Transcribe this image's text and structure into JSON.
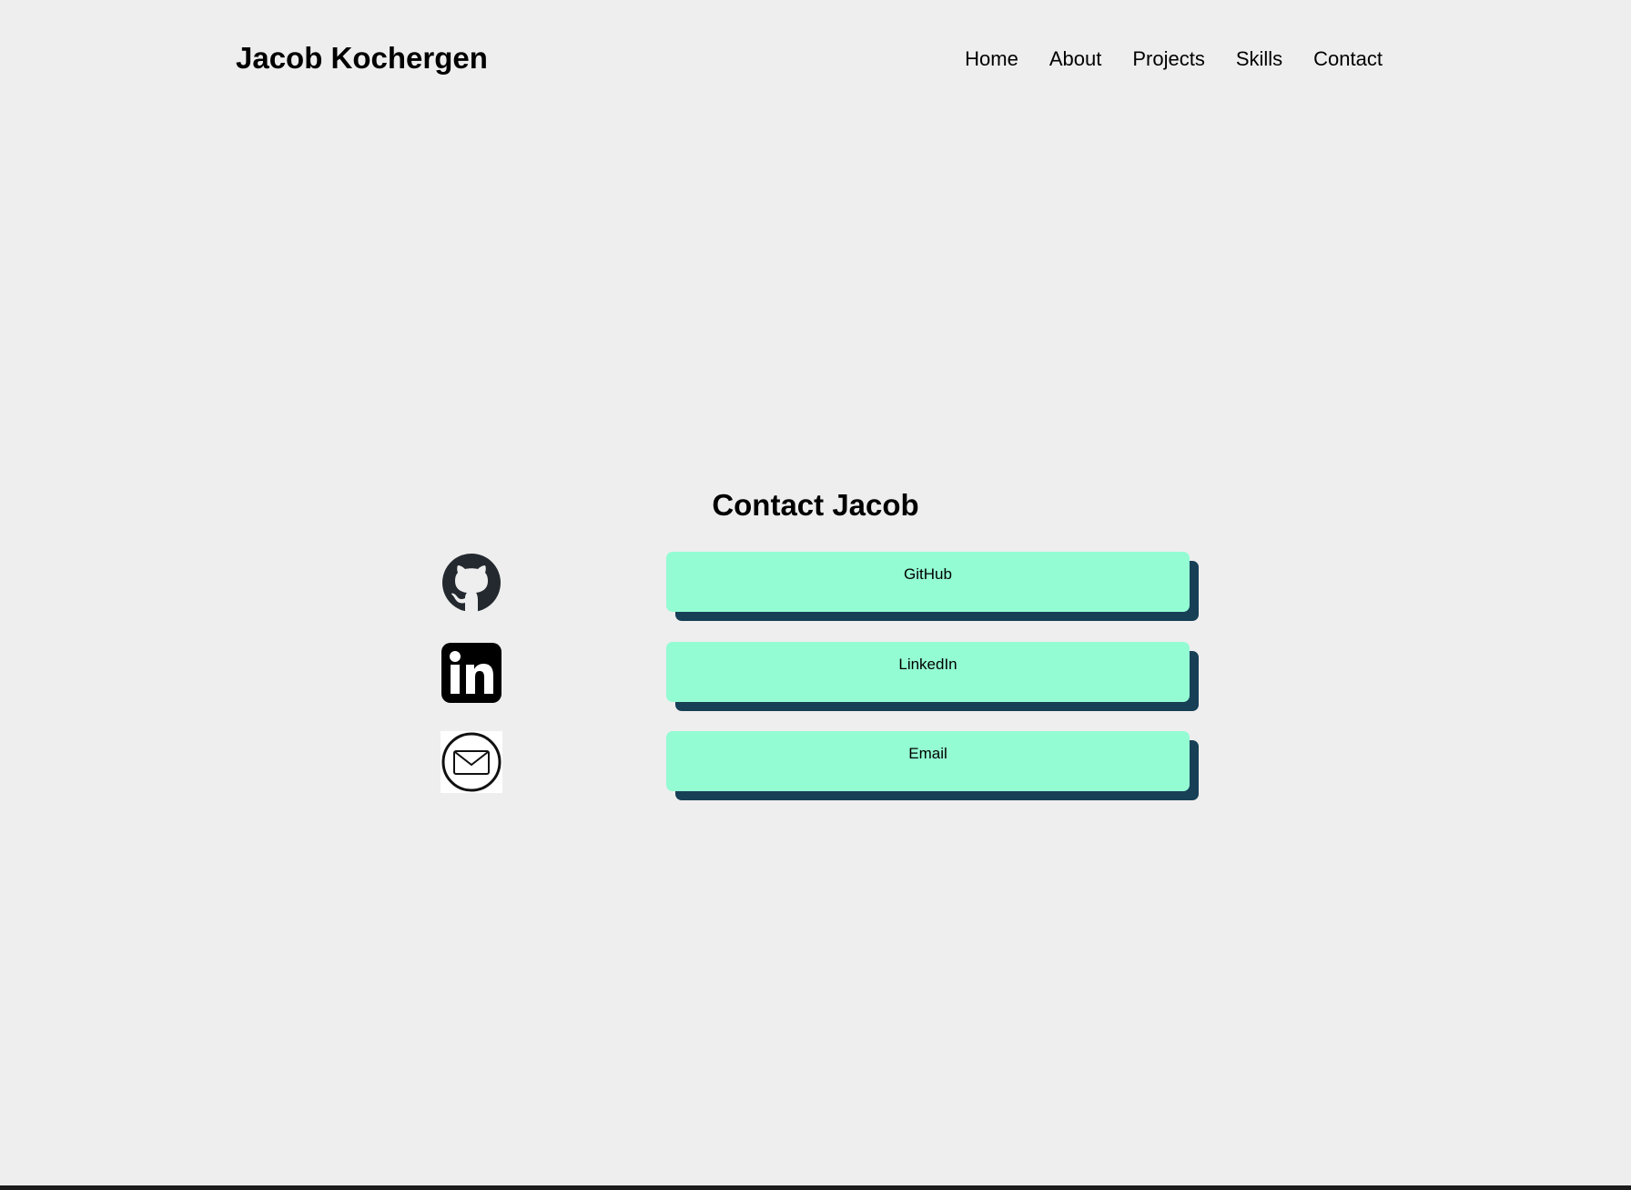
{
  "header": {
    "brand": "Jacob Kochergen",
    "nav": [
      "Home",
      "About",
      "Projects",
      "Skills",
      "Contact"
    ]
  },
  "contact": {
    "title": "Contact Jacob",
    "links": [
      {
        "label": "GitHub",
        "icon": "github-icon"
      },
      {
        "label": "LinkedIn",
        "icon": "linkedin-icon"
      },
      {
        "label": "Email",
        "icon": "email-icon"
      }
    ]
  },
  "colors": {
    "background": "#eeeeee",
    "button": "#93fcd3",
    "button_shadow": "#173f56",
    "footer": "#1c1c1c"
  }
}
